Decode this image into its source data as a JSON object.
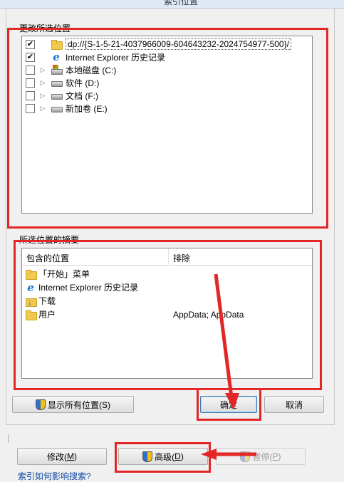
{
  "window": {
    "title": "索引位置"
  },
  "tree_section": {
    "label": "更改所选位置",
    "items": [
      {
        "checked": true,
        "expander": "",
        "icon": "folder-icon",
        "label": "dp://{S-1-5-21-4037966009-604643232-2024754977-500}/",
        "selected": true
      },
      {
        "checked": true,
        "expander": "",
        "icon": "internet-explorer-icon",
        "label": "Internet Explorer 历史记录",
        "selected": false
      },
      {
        "checked": false,
        "expander": "▷",
        "icon": "system-drive-icon",
        "label": "本地磁盘 (C:)",
        "selected": false
      },
      {
        "checked": false,
        "expander": "▷",
        "icon": "drive-icon",
        "label": "软件 (D:)",
        "selected": false
      },
      {
        "checked": false,
        "expander": "▷",
        "icon": "drive-icon",
        "label": "文档 (F:)",
        "selected": false
      },
      {
        "checked": false,
        "expander": "▷",
        "icon": "drive-icon",
        "label": "新加卷 (E:)",
        "selected": false
      }
    ]
  },
  "summary_section": {
    "label": "所选位置的摘要",
    "columns": {
      "included": "包含的位置",
      "excluded": "排除"
    },
    "rows": [
      {
        "icon": "folder-icon",
        "location": "「开始」菜单",
        "exclude": ""
      },
      {
        "icon": "internet-explorer-icon",
        "location": "Internet Explorer 历史记录",
        "exclude": ""
      },
      {
        "icon": "downloads-folder-icon",
        "location": "下载",
        "exclude": ""
      },
      {
        "icon": "folder-icon",
        "location": "用户",
        "exclude": "AppData; AppData"
      }
    ]
  },
  "buttons": {
    "show_all": "显示所有位置(S)",
    "ok": "确定",
    "cancel": "取消",
    "modify": "修改(",
    "modify_key": "M",
    "modify_end": ")",
    "advanced": "高级(",
    "advanced_key": "D",
    "advanced_end": ")",
    "pause": "暂停(",
    "pause_key": "P",
    "pause_end": ")"
  },
  "hint": {
    "text": "索引如何影响搜索?"
  },
  "colors": {
    "annotation": "#e32626"
  },
  "check_mark": "✔"
}
